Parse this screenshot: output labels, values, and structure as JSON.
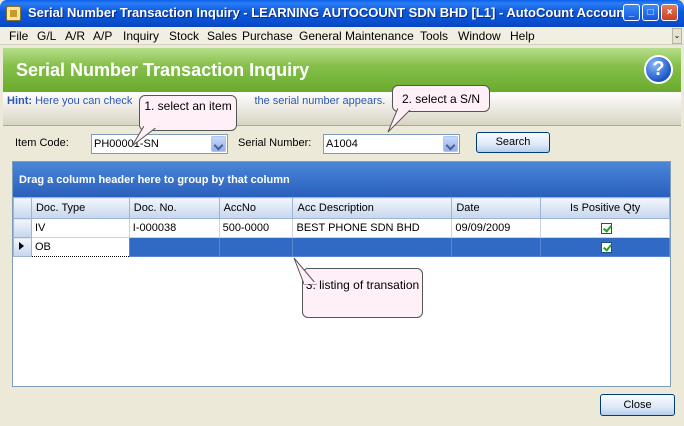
{
  "window": {
    "title": "Serial Number Transaction Inquiry - LEARNING AUTOCOUNT SDN BHD [L1] - AutoCount Account...",
    "min": "_",
    "max": "□",
    "close": "×"
  },
  "menu": [
    "File",
    "G/L",
    "A/R",
    "A/P",
    "Inquiry",
    "Stock",
    "Sales",
    "Purchase",
    "General Maintenance",
    "Tools",
    "Window",
    "Help"
  ],
  "header": {
    "title": "Serial Number Transaction Inquiry",
    "help": "?"
  },
  "hint": {
    "label": "Hint:",
    "text_before": " Here you can check",
    "text_after": "the serial number appears."
  },
  "form": {
    "item_code_label": "Item Code:",
    "item_code_value": "PH00001-SN",
    "serial_label": "Serial Number:",
    "serial_value": "A1004",
    "search_label": "Search"
  },
  "grid": {
    "group_hint": "Drag a column header here to group by that column",
    "columns": [
      "Doc. Type",
      "Doc. No.",
      "AccNo",
      "Acc Description",
      "Date",
      "Is Positive Qty"
    ],
    "rows": [
      [
        "IV",
        "I-000038",
        "500-0000",
        "BEST PHONE SDN BHD",
        "09/09/2009",
        true
      ],
      [
        "OB",
        "",
        "",
        "",
        "",
        true
      ]
    ]
  },
  "callouts": {
    "c1": "1. select an item",
    "c2": "2. select a S/N",
    "c3": "3. listing of transation"
  },
  "footer": {
    "close_label": "Close"
  },
  "colors": {
    "titlebar": "#0a4fd0",
    "header_green": "#86c04a",
    "selection": "#316ac5",
    "callout": "#fff0f8"
  }
}
